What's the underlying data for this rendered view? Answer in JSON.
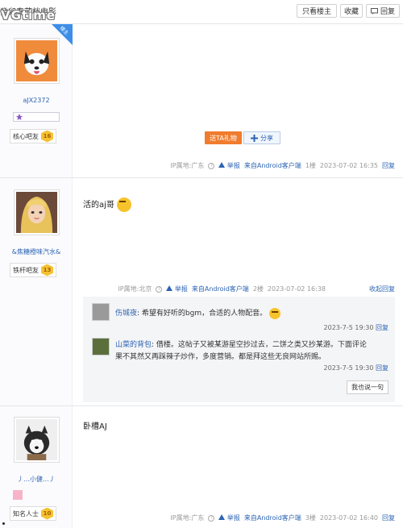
{
  "toolbar": {
    "title": "癸卯春节档电影",
    "watermark": "VGtime",
    "only_op_label": "只看楼主",
    "favorite_label": "收藏",
    "reply_label": "回复"
  },
  "posts": [
    {
      "username": "aJX2372",
      "level_name": "核心吧友",
      "level_num": "16",
      "corner_badge": "楼主",
      "gift_label": "送TA礼物",
      "share_label": "分享",
      "ip": "IP属地:广东",
      "report": "举报",
      "client": "来自Android客户端",
      "floor": "1楼",
      "time": "2023-07-02 16:35",
      "reply": "回复"
    },
    {
      "username": "&焦糖橙味汽水&",
      "level_name": "铁杆吧友",
      "level_num": "13",
      "content": "活的aj哥",
      "ip": "IP属地:北京",
      "report": "举报",
      "client": "来自Android客户端",
      "floor": "2楼",
      "time": "2023-07-02 16:38",
      "collapse": "收起回复",
      "sub_replies": [
        {
          "name": "伤城夜",
          "text": ": 希望有好听的bgm，合适的人物配音。",
          "time": "2023-7-5 19:30",
          "reply": "回复"
        },
        {
          "name": "山菜的背包",
          "text": ": 借楼。这帖子又被某游星空抄过去，二饼之类又抄某游。下面评论",
          "text2": "果不其然又再踩辣子炒作，多度营销。都是拜这些无良网站所赐。",
          "time": "2023-7-5 19:30",
          "reply": "回复"
        }
      ],
      "say_label": "我也说一句"
    },
    {
      "username": "丿...小健...丿",
      "level_name": "知名人士",
      "level_num": "10",
      "content": "卧槽AJ",
      "ip": "IP属地:广东",
      "report": "举报",
      "client": "来自Android客户端",
      "floor": "3楼",
      "time": "2023-07-02 16:40",
      "reply": "回复"
    }
  ],
  "colors": {
    "link": "#2d64b3",
    "gift": "#f07c2e",
    "badge": "#3d8ee8",
    "level": "#f5c232"
  }
}
